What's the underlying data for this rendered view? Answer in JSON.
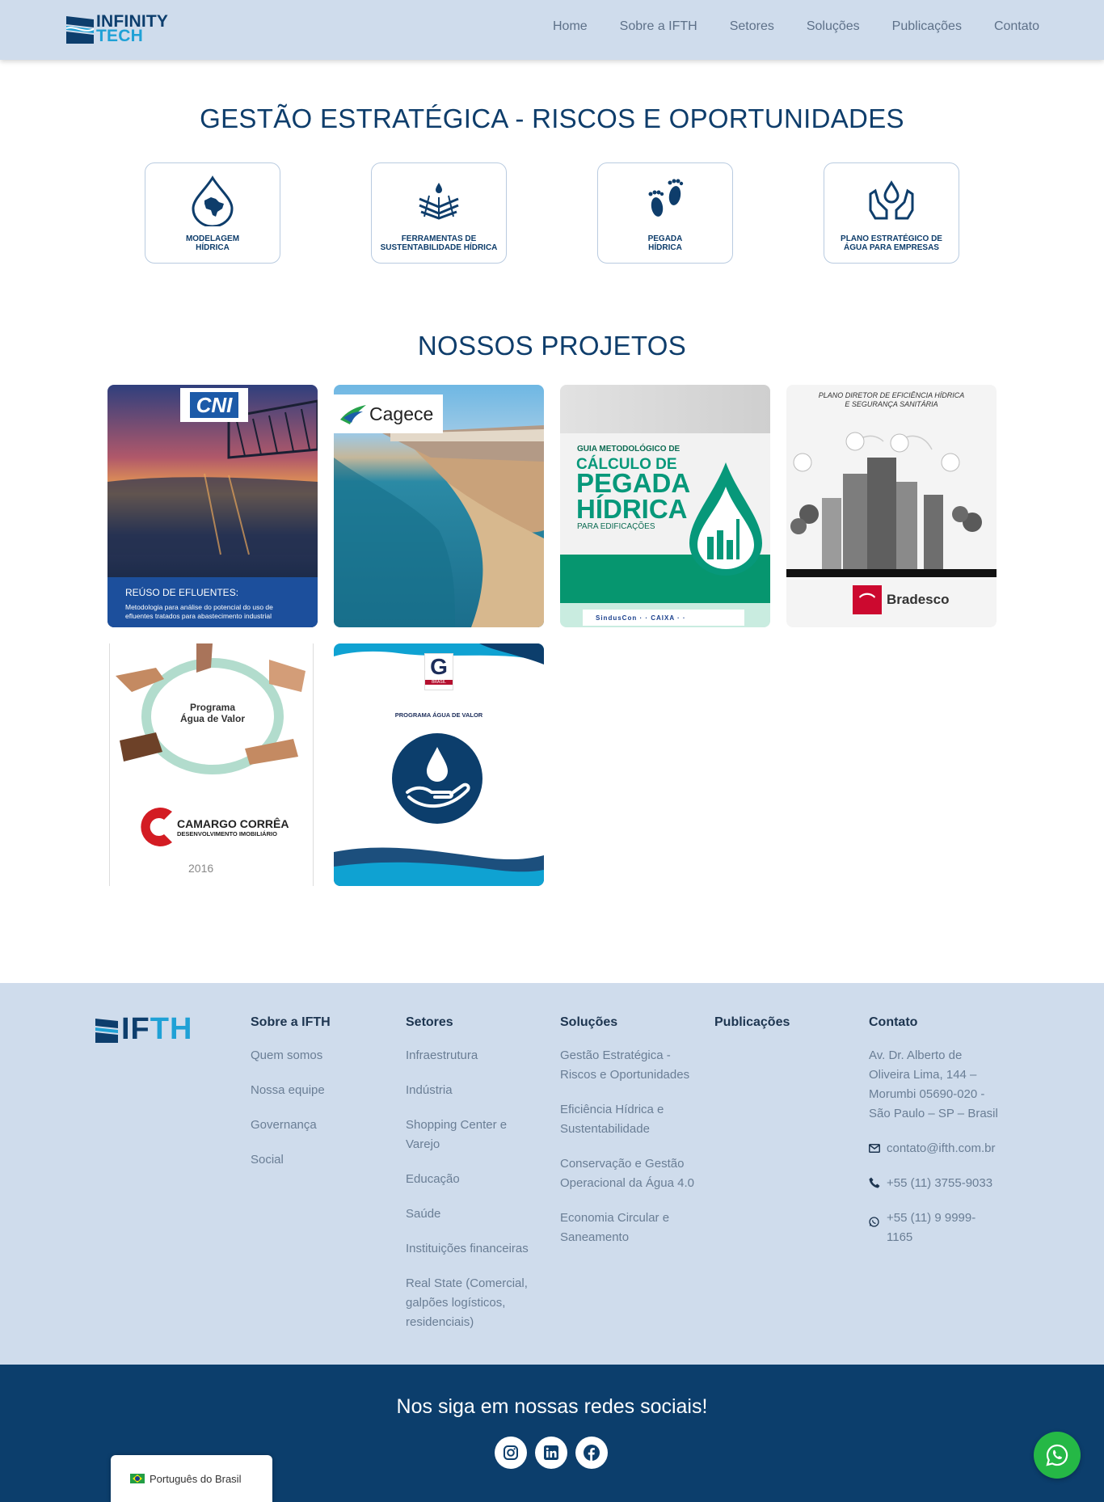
{
  "brand": {
    "logo_line1": "INFINITY",
    "logo_line2": "TECH",
    "footer_logo_a": "IF",
    "footer_logo_b": "TH"
  },
  "nav": [
    "Home",
    "Sobre a IFTH",
    "Setores",
    "Soluções",
    "Publicações",
    "Contato"
  ],
  "strategy": {
    "title": "GESTÃO ESTRATÉGICA - RISCOS E OPORTUNIDADES",
    "cards": [
      {
        "line1": "MODELAGEM",
        "line2": "HÍDRICA",
        "icon": "water-map-icon"
      },
      {
        "line1": "FERRAMENTAS DE",
        "line2": "SUSTENTABILIDADE HÍDRICA",
        "icon": "water-hands-icon"
      },
      {
        "line1": "PEGADA",
        "line2": "HÍDRICA",
        "icon": "footprints-icon"
      },
      {
        "line1": "PLANO ESTRATÉGICO DE",
        "line2": "ÁGUA PARA EMPRESAS",
        "icon": "hands-drop-icon"
      }
    ]
  },
  "projects": {
    "title": "NOSSOS PROJETOS",
    "cni": {
      "logo": "CNI",
      "heading": "REÚSO DE EFLUENTES:",
      "line1": "Metodologia para análise do potencial do uso de",
      "line2": "efluentes tratados para abastecimento industrial"
    },
    "cagece": {
      "logo": "Cagece"
    },
    "pegada": {
      "pre": "GUIA METODOLÓGICO DE",
      "l1": "CÁLCULO DE",
      "l2": "PEGADA",
      "l3": "HÍDRICA",
      "sub": "PARA EDIFICAÇÕES",
      "footer_logos": "SindusCon · · CAIXA · ·"
    },
    "bradesco": {
      "t1": "PLANO DIRETOR DE EFICIÊNCIA HÍDRICA",
      "t2": "E SEGURANÇA SANITÁRIA",
      "name": "Bradesco"
    },
    "camargo": {
      "p1": "Programa",
      "p2": "Água de Valor",
      "n1": "CAMARGO CORRÊA",
      "n2": "DESENVOLVIMENTO IMOBILIÁRIO",
      "year": "2016"
    },
    "gbc": {
      "badge": "BRASIL",
      "program": "PROGRAMA ÁGUA DE VALOR"
    }
  },
  "footer": {
    "sobre": {
      "title": "Sobre a IFTH",
      "items": [
        "Quem somos",
        "Nossa equipe",
        "Governança",
        "Social"
      ]
    },
    "setores": {
      "title": "Setores",
      "items": [
        "Infraestrutura",
        "Indústria",
        "Shopping Center e Varejo",
        "Educação",
        "Saúde",
        "Instituições financeiras",
        "Real State (Comercial, galpões logísticos, residenciais)"
      ]
    },
    "solucoes": {
      "title": "Soluções",
      "items": [
        "Gestão Estratégica - Riscos e Oportunidades",
        "Eficiência Hídrica e Sustentabilidade",
        "Conservação e Gestão Operacional da Água 4.0",
        "Economia Circular e Saneamento"
      ]
    },
    "publicacoes": {
      "title": "Publicações"
    },
    "contato": {
      "title": "Contato",
      "address": "Av. Dr. Alberto de Oliveira Lima, 144 – Morumbi 05690-020 - São Paulo – SP – Brasil",
      "email": "contato@ifth.com.br",
      "phone": "+55 (11) 3755-9033",
      "whatsapp": "+55 (11) 9 9999-1165"
    }
  },
  "social": {
    "title": "Nos siga em nossas redes sociais!",
    "icons": [
      "instagram-icon",
      "linkedin-icon",
      "facebook-icon"
    ]
  },
  "language": {
    "label": "Português do Brasil"
  },
  "colors": {
    "navy": "#0e3d6b",
    "light_blue_bg": "#cfdcec",
    "accent": "#1fa1d6",
    "whatsapp": "#25b846"
  }
}
